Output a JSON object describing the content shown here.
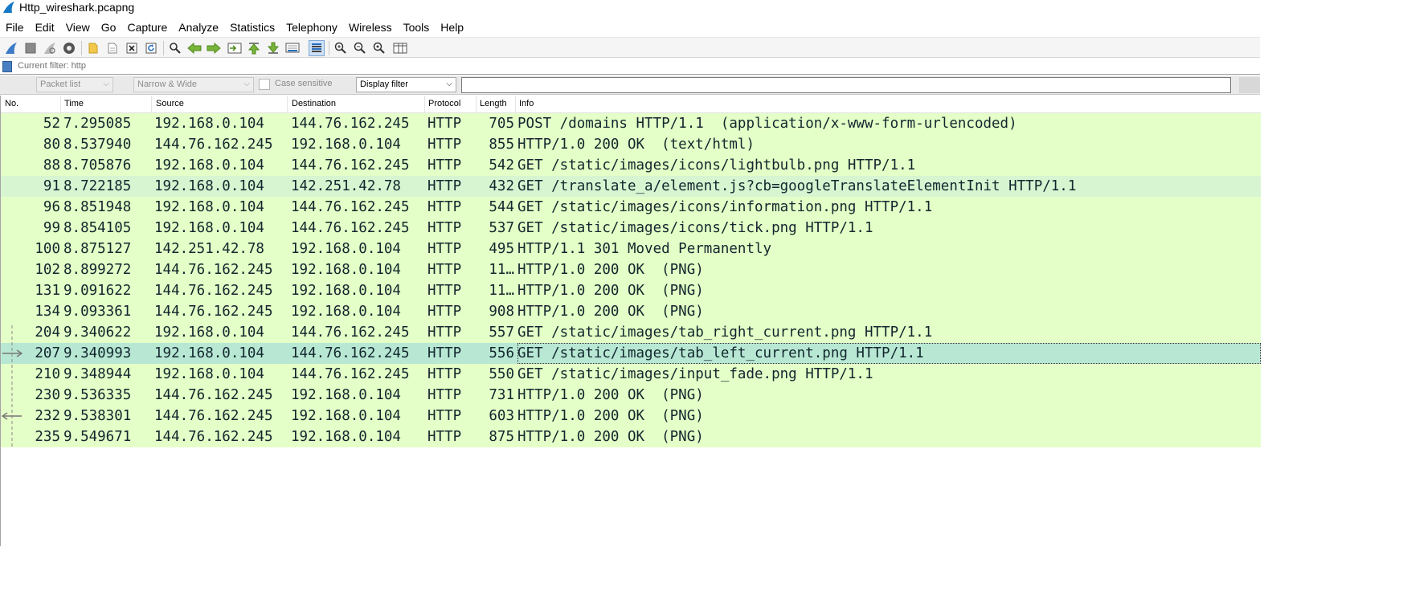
{
  "window": {
    "title": "Http_wireshark.pcapng"
  },
  "menu": [
    "File",
    "Edit",
    "View",
    "Go",
    "Capture",
    "Analyze",
    "Statistics",
    "Telephony",
    "Wireless",
    "Tools",
    "Help"
  ],
  "toolbar": {
    "buttons": [
      "start-capture-icon",
      "stop-capture-icon",
      "restart-capture-icon",
      "capture-options-icon",
      "open-file-icon",
      "save-file-icon",
      "close-file-icon",
      "reload-file-icon",
      "find-packet-icon",
      "go-back-icon",
      "go-forward-icon",
      "go-to-packet-icon",
      "go-first-icon",
      "go-last-icon",
      "autoscroll-icon",
      "colorize-icon",
      "zoom-in-icon",
      "zoom-out-icon",
      "zoom-normal-icon",
      "resize-columns-icon"
    ]
  },
  "filter_bar": {
    "current_filter": "Current filter: http"
  },
  "find_bar": {
    "search_in": "Packet list",
    "char_width": "Narrow & Wide",
    "case_sensitive_label": "Case sensitive",
    "search_type": "Display filter",
    "search_value": ""
  },
  "packet_list": {
    "columns": [
      "No.",
      "Time",
      "Source",
      "Destination",
      "Protocol",
      "Length",
      "Info"
    ],
    "rows": [
      {
        "no": "52",
        "time": "7.295085",
        "src": "192.168.0.104",
        "dst": "144.76.162.245",
        "proto": "HTTP",
        "len": "705",
        "info": "POST /domains HTTP/1.1  (application/x-www-form-urlencoded)"
      },
      {
        "no": "80",
        "time": "8.537940",
        "src": "144.76.162.245",
        "dst": "192.168.0.104",
        "proto": "HTTP",
        "len": "855",
        "info": "HTTP/1.0 200 OK  (text/html)"
      },
      {
        "no": "88",
        "time": "8.705876",
        "src": "192.168.0.104",
        "dst": "144.76.162.245",
        "proto": "HTTP",
        "len": "542",
        "info": "GET /static/images/icons/lightbulb.png HTTP/1.1"
      },
      {
        "no": "91",
        "time": "8.722185",
        "src": "192.168.0.104",
        "dst": "142.251.42.78",
        "proto": "HTTP",
        "len": "432",
        "info": "GET /translate_a/element.js?cb=googleTranslateElementInit HTTP/1.1"
      },
      {
        "no": "96",
        "time": "8.851948",
        "src": "192.168.0.104",
        "dst": "144.76.162.245",
        "proto": "HTTP",
        "len": "544",
        "info": "GET /static/images/icons/information.png HTTP/1.1"
      },
      {
        "no": "99",
        "time": "8.854105",
        "src": "192.168.0.104",
        "dst": "144.76.162.245",
        "proto": "HTTP",
        "len": "537",
        "info": "GET /static/images/icons/tick.png HTTP/1.1"
      },
      {
        "no": "100",
        "time": "8.875127",
        "src": "142.251.42.78",
        "dst": "192.168.0.104",
        "proto": "HTTP",
        "len": "495",
        "info": "HTTP/1.1 301 Moved Permanently"
      },
      {
        "no": "102",
        "time": "8.899272",
        "src": "144.76.162.245",
        "dst": "192.168.0.104",
        "proto": "HTTP",
        "len": "11…",
        "info": "HTTP/1.0 200 OK  (PNG)"
      },
      {
        "no": "131",
        "time": "9.091622",
        "src": "144.76.162.245",
        "dst": "192.168.0.104",
        "proto": "HTTP",
        "len": "11…",
        "info": "HTTP/1.0 200 OK  (PNG)"
      },
      {
        "no": "134",
        "time": "9.093361",
        "src": "144.76.162.245",
        "dst": "192.168.0.104",
        "proto": "HTTP",
        "len": "908",
        "info": "HTTP/1.0 200 OK  (PNG)"
      },
      {
        "no": "204",
        "time": "9.340622",
        "src": "192.168.0.104",
        "dst": "144.76.162.245",
        "proto": "HTTP",
        "len": "557",
        "info": "GET /static/images/tab_right_current.png HTTP/1.1"
      },
      {
        "no": "207",
        "time": "9.340993",
        "src": "192.168.0.104",
        "dst": "144.76.162.245",
        "proto": "HTTP",
        "len": "556",
        "info": "GET /static/images/tab_left_current.png HTTP/1.1"
      },
      {
        "no": "210",
        "time": "9.348944",
        "src": "192.168.0.104",
        "dst": "144.76.162.245",
        "proto": "HTTP",
        "len": "550",
        "info": "GET /static/images/input_fade.png HTTP/1.1"
      },
      {
        "no": "230",
        "time": "9.536335",
        "src": "144.76.162.245",
        "dst": "192.168.0.104",
        "proto": "HTTP",
        "len": "731",
        "info": "HTTP/1.0 200 OK  (PNG)"
      },
      {
        "no": "232",
        "time": "9.538301",
        "src": "144.76.162.245",
        "dst": "192.168.0.104",
        "proto": "HTTP",
        "len": "603",
        "info": "HTTP/1.0 200 OK  (PNG)"
      },
      {
        "no": "235",
        "time": "9.549671",
        "src": "144.76.162.245",
        "dst": "192.168.0.104",
        "proto": "HTTP",
        "len": "875",
        "info": "HTTP/1.0 200 OK  (PNG)"
      }
    ],
    "selected_row": "207",
    "colors": {
      "http_row_bg": "#e4ffc7",
      "alt_row_bg": "#d7f5d1",
      "selected_row_bg": "#b8e8d4",
      "row_text": "#12272e"
    }
  }
}
